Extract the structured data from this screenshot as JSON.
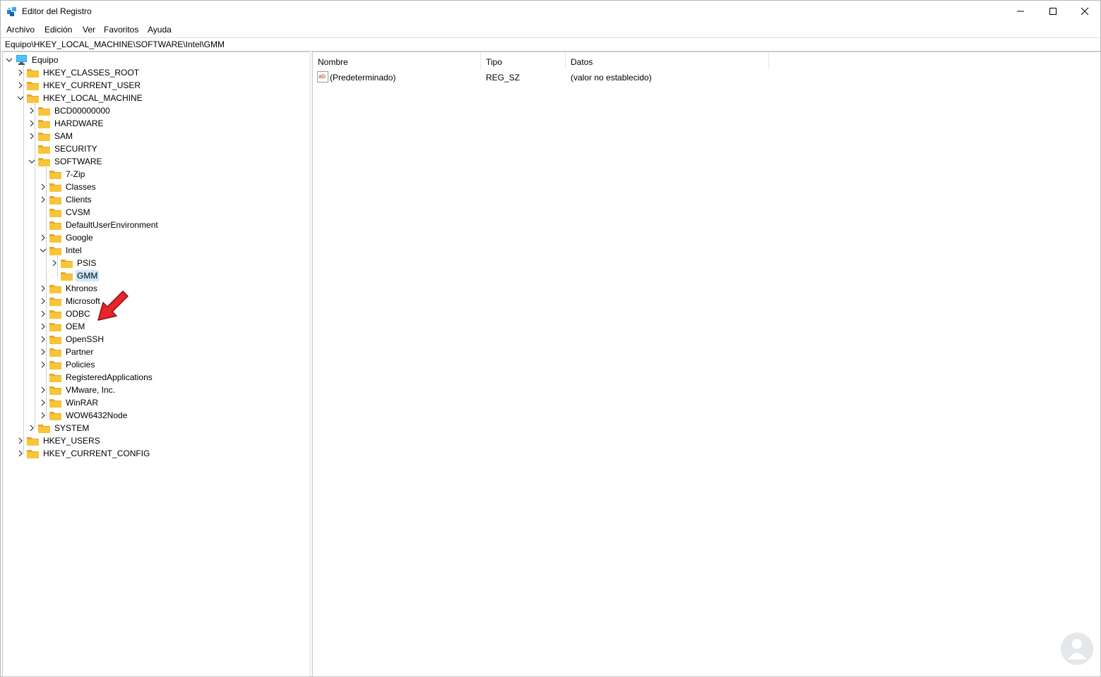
{
  "window": {
    "title": "Editor del Registro",
    "minimize_icon": "minimize-icon",
    "maximize_icon": "maximize-icon",
    "close_icon": "close-icon"
  },
  "menu": {
    "archivo": "Archivo",
    "edicion": "Edición",
    "ver": "Ver",
    "favoritos": "Favoritos",
    "ayuda": "Ayuda"
  },
  "address": "Equipo\\HKEY_LOCAL_MACHINE\\SOFTWARE\\Intel\\GMM",
  "tree": {
    "equipo": "Equipo",
    "hkcr": "HKEY_CLASSES_ROOT",
    "hkcu": "HKEY_CURRENT_USER",
    "hklm": "HKEY_LOCAL_MACHINE",
    "bcd": "BCD00000000",
    "hardware": "HARDWARE",
    "sam": "SAM",
    "security": "SECURITY",
    "software": "SOFTWARE",
    "zip": "7-Zip",
    "classes": "Classes",
    "clients": "Clients",
    "cvsm": "CVSM",
    "defaultuser": "DefaultUserEnvironment",
    "google": "Google",
    "intel": "Intel",
    "psis": "PSIS",
    "gmm": "GMM",
    "khronos": "Khronos",
    "microsoft": "Microsoft",
    "odbc": "ODBC",
    "oem": "OEM",
    "openssh": "OpenSSH",
    "partner": "Partner",
    "policies": "Policies",
    "registered": "RegisteredApplications",
    "vmware": "VMware, Inc.",
    "winrar": "WinRAR",
    "wow": "WOW6432Node",
    "system": "SYSTEM",
    "hku": "HKEY_USERS",
    "hkcc": "HKEY_CURRENT_CONFIG"
  },
  "columns": {
    "nombre": "Nombre",
    "tipo": "Tipo",
    "datos": "Datos"
  },
  "values": [
    {
      "name": "(Predeterminado)",
      "type": "REG_SZ",
      "data": "(valor no establecido)"
    }
  ],
  "colors": {
    "selection": "#cce8ff",
    "folder": "#f8c43a",
    "arrow": "#e8262a"
  }
}
